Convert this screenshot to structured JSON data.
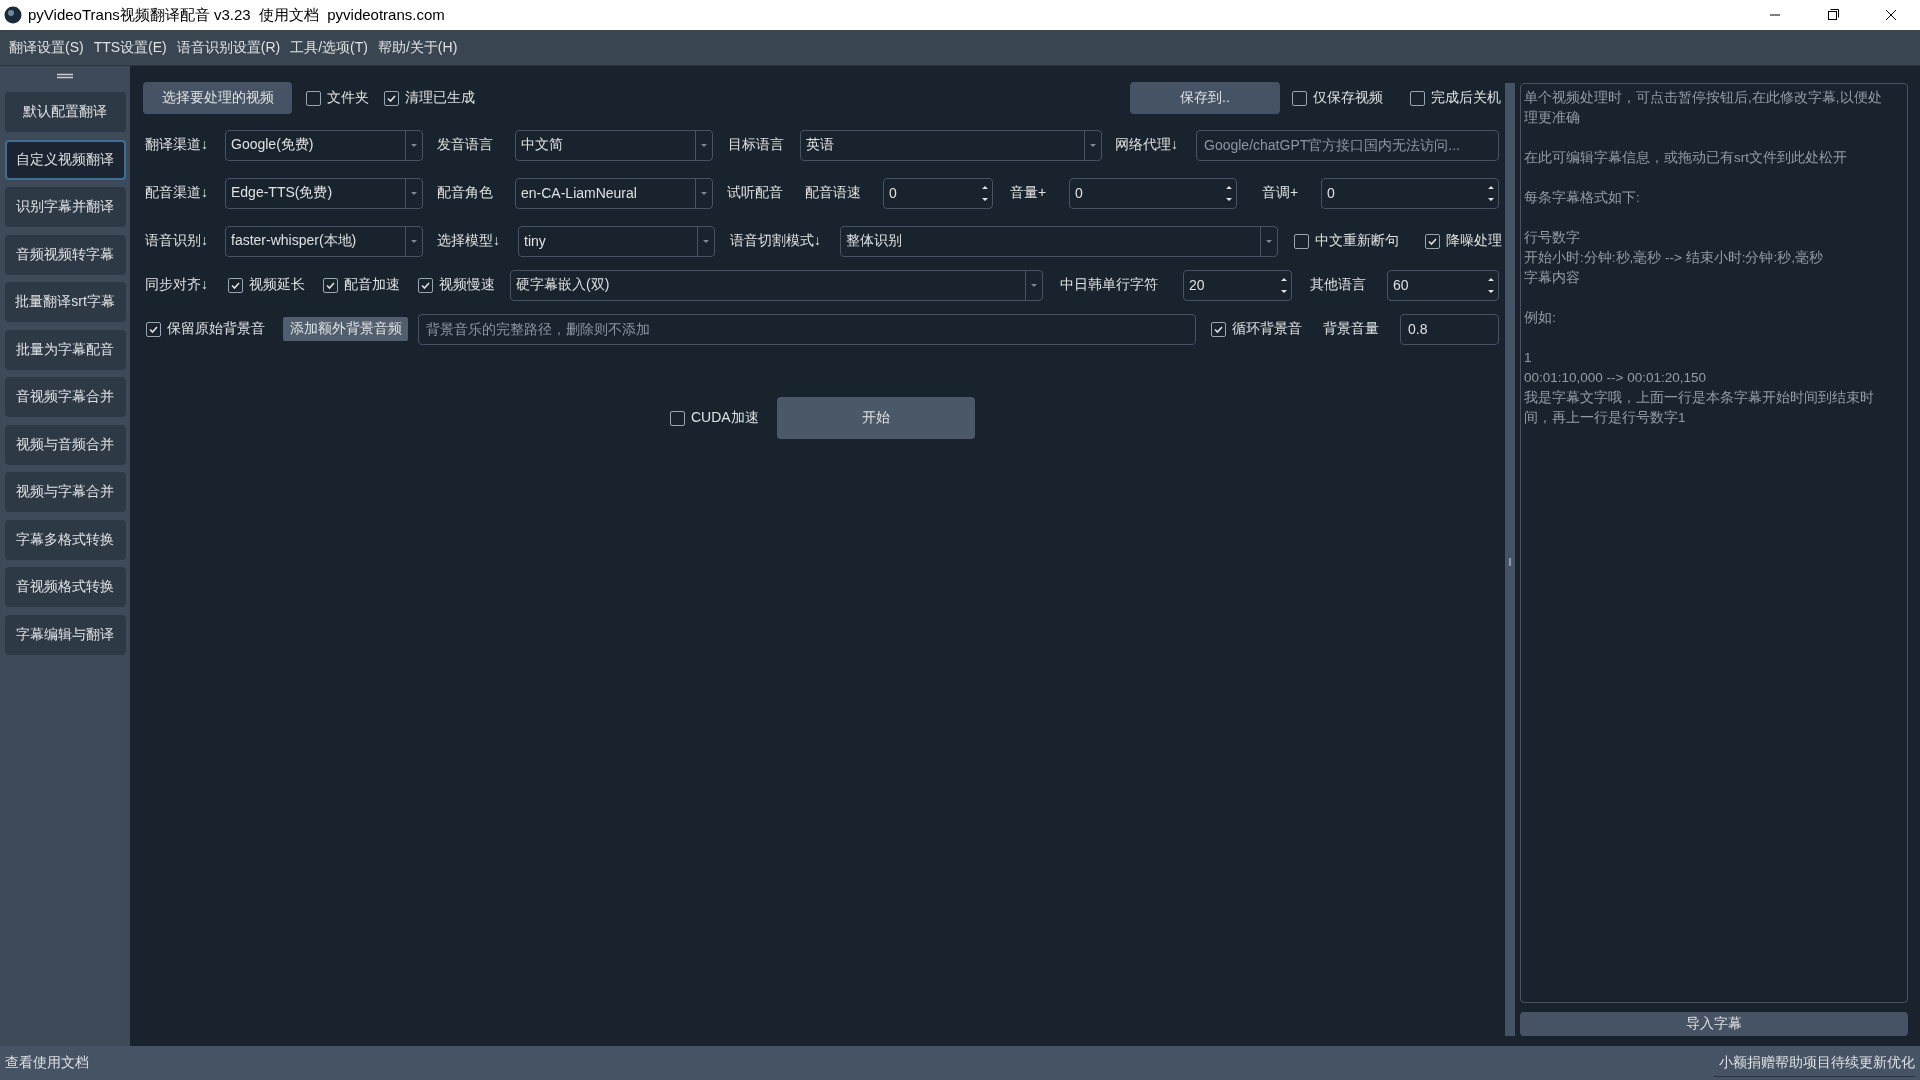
{
  "window": {
    "title": "pyVideoTrans视频翻译配音 v3.23  使用文档  pyvideotrans.com"
  },
  "menu": [
    "翻译设置(S)",
    "TTS设置(E)",
    "语音识别设置(R)",
    "工具/选项(T)",
    "帮助/关于(H)"
  ],
  "sidebar": {
    "items": [
      {
        "label": "默认配置翻译",
        "selected": false
      },
      {
        "label": "自定义视频翻译",
        "selected": true
      },
      {
        "label": "识别字幕并翻译",
        "selected": false
      },
      {
        "label": "音频视频转字幕",
        "selected": false
      },
      {
        "label": "批量翻译srt字幕",
        "selected": false
      },
      {
        "label": "批量为字幕配音",
        "selected": false
      },
      {
        "label": "音视频字幕合并",
        "selected": false
      },
      {
        "label": "视频与音频合并",
        "selected": false
      },
      {
        "label": "视频与字幕合并",
        "selected": false
      },
      {
        "label": "字幕多格式转换",
        "selected": false
      },
      {
        "label": "音视频格式转换",
        "selected": false
      },
      {
        "label": "字幕编辑与翻译",
        "selected": false
      }
    ]
  },
  "form": {
    "rows": [
      {
        "items": [
          {
            "kind": "button",
            "label": "选择要处理的视频"
          },
          {
            "kind": "check",
            "label": "文件夹",
            "checked": false
          },
          {
            "kind": "check",
            "label": "清理已生成",
            "checked": true
          },
          {
            "kind": "button",
            "label": "保存到.."
          },
          {
            "kind": "check",
            "label": "仅保存视频",
            "checked": false
          },
          {
            "kind": "check",
            "label": "完成后关机",
            "checked": false
          }
        ]
      },
      {
        "items": [
          {
            "kind": "label",
            "text": "翻译渠道↓"
          },
          {
            "kind": "combo",
            "value": "Google(免费)"
          },
          {
            "kind": "label",
            "text": "发音语言"
          },
          {
            "kind": "combo",
            "value": "中文简"
          },
          {
            "kind": "label",
            "text": "目标语言"
          },
          {
            "kind": "combo",
            "value": "英语"
          },
          {
            "kind": "label",
            "text": "网络代理↓"
          },
          {
            "kind": "input",
            "placeholder": "Google/chatGPT官方接口国内无法访问..."
          }
        ]
      },
      {
        "items": [
          {
            "kind": "label",
            "text": "配音渠道↓"
          },
          {
            "kind": "combo",
            "value": "Edge-TTS(免费)"
          },
          {
            "kind": "label",
            "text": "配音角色"
          },
          {
            "kind": "combo",
            "value": "en-CA-LiamNeural"
          },
          {
            "kind": "label",
            "text": "试听配音"
          },
          {
            "kind": "label",
            "text": "配音语速"
          },
          {
            "kind": "spin",
            "value": "0"
          },
          {
            "kind": "label",
            "text": "音量+"
          },
          {
            "kind": "spin",
            "value": "0"
          },
          {
            "kind": "label",
            "text": "音调+"
          },
          {
            "kind": "spin",
            "value": "0"
          }
        ]
      },
      {
        "items": [
          {
            "kind": "label",
            "text": "语音识别↓"
          },
          {
            "kind": "combo",
            "value": "faster-whisper(本地)"
          },
          {
            "kind": "label",
            "text": "选择模型↓"
          },
          {
            "kind": "combo",
            "value": "tiny"
          },
          {
            "kind": "label",
            "text": "语音切割模式↓"
          },
          {
            "kind": "combo",
            "value": "整体识别"
          },
          {
            "kind": "check",
            "label": "中文重新断句",
            "checked": false
          },
          {
            "kind": "check",
            "label": "降噪处理",
            "checked": true
          }
        ]
      },
      {
        "items": [
          {
            "kind": "label",
            "text": "同步对齐↓"
          },
          {
            "kind": "check",
            "label": "视频延长",
            "checked": true
          },
          {
            "kind": "check",
            "label": "配音加速",
            "checked": true
          },
          {
            "kind": "check",
            "label": "视频慢速",
            "checked": true
          },
          {
            "kind": "combo",
            "value": "硬字幕嵌入(双)"
          },
          {
            "kind": "label",
            "text": "中日韩单行字符"
          },
          {
            "kind": "spin",
            "value": "20"
          },
          {
            "kind": "label",
            "text": "其他语言"
          },
          {
            "kind": "spin",
            "value": "60"
          }
        ]
      },
      {
        "items": [
          {
            "kind": "check",
            "label": "保留原始背景音",
            "checked": true
          },
          {
            "kind": "button",
            "label": "添加额外背景音频"
          },
          {
            "kind": "input",
            "placeholder": "背景音乐的完整路径，删除则不添加"
          },
          {
            "kind": "check",
            "label": "循环背景音",
            "checked": true
          },
          {
            "kind": "label",
            "text": "背景音量"
          },
          {
            "kind": "input",
            "value": "0.8"
          }
        ]
      },
      {
        "items": [
          {
            "kind": "check",
            "label": "CUDA加速",
            "checked": false
          },
          {
            "kind": "button",
            "label": "开始"
          }
        ]
      }
    ]
  },
  "subtitle_panel": {
    "hint_paragraphs": [
      [
        "单个视频处理时，可点击暂停按钮后,在此修改字幕,以便处理更准确"
      ],
      [
        "在此可编辑字幕信息，或拖动已有srt文件到此处松开"
      ],
      [
        "每条字幕格式如下:"
      ],
      [
        "行号数字",
        "开始小时:分钟:秒,毫秒 --> 结束小时:分钟:秒,毫秒",
        "字幕内容"
      ],
      [
        "例如:"
      ],
      [
        "1",
        "00:01:10,000 --> 00:01:20,150",
        "我是字幕文字哦，上面一行是本条字幕开始时间到结束时间，再上一行是行号数字1"
      ]
    ],
    "button": "导入字幕"
  },
  "status_bar": {
    "left": "查看使用文档",
    "right": "小额捐赠帮助项目待续更新优化"
  }
}
